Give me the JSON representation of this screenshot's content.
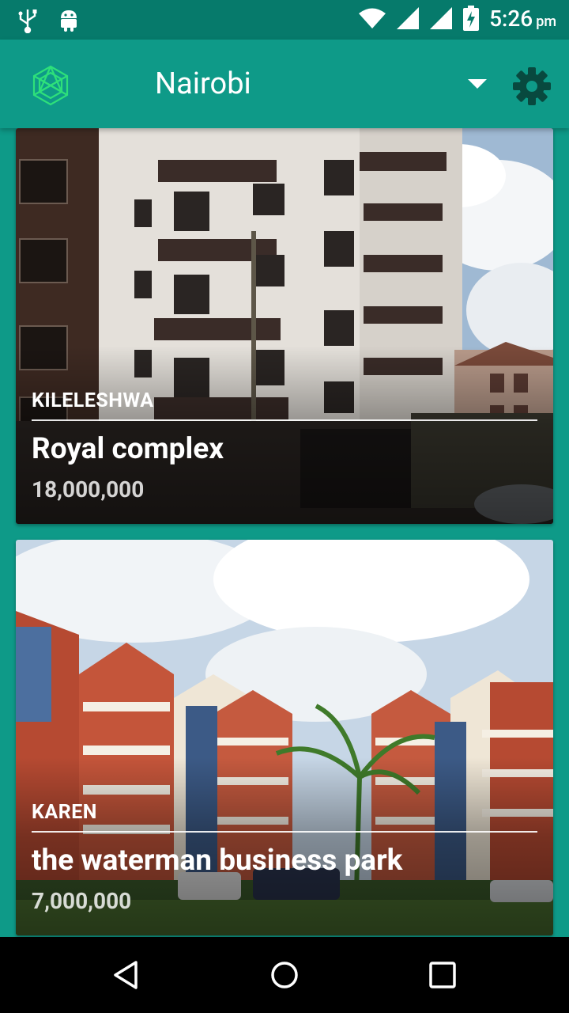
{
  "status_bar": {
    "time": "5:26",
    "ampm": "pm",
    "icons": [
      "usb-icon",
      "android-icon",
      "wifi-icon",
      "signal-icon",
      "signal-icon",
      "battery-charging-icon"
    ]
  },
  "app_bar": {
    "title": "Nairobi",
    "logo_icon": "hexagon-logo-icon",
    "dropdown_icon": "triangle-down-icon",
    "settings_icon": "gear-icon"
  },
  "listings": [
    {
      "area": "KILELESHWA",
      "name": "Royal complex",
      "price": "18,000,000"
    },
    {
      "area": "KAREN",
      "name": "the waterman business park",
      "price": "7,000,000"
    }
  ],
  "nav_bar": {
    "icons": [
      "back-icon",
      "home-icon",
      "recents-icon"
    ]
  },
  "colors": {
    "primary": "#0e9a88",
    "status_bar": "#067a6b",
    "logo_green": "#2ee07a"
  }
}
